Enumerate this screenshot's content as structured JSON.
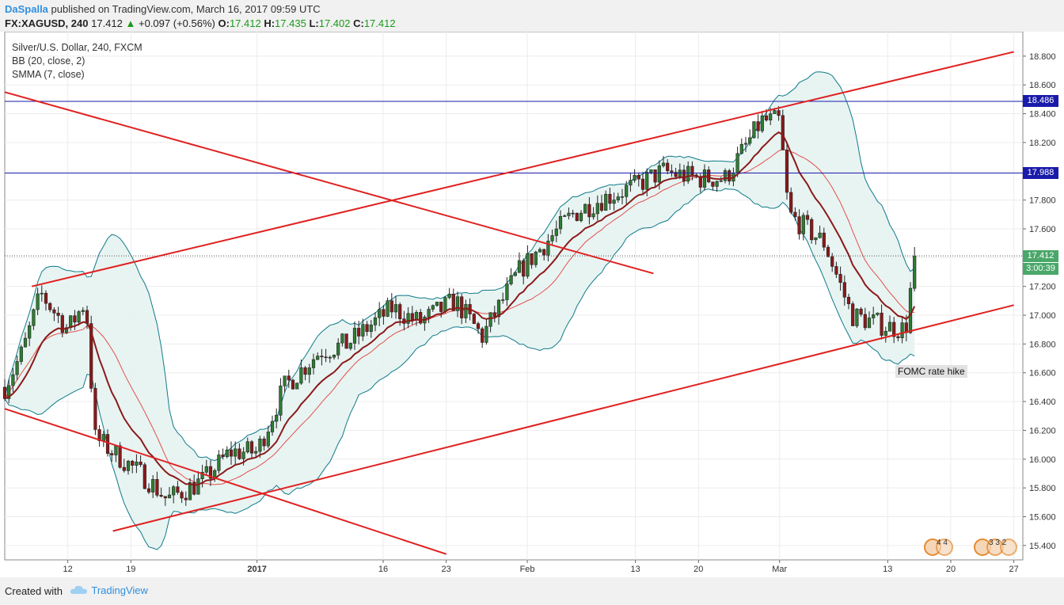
{
  "header": {
    "author": "DaSpalla",
    "published": "published on TradingView.com, March 16, 2017 09:59 UTC",
    "symbol": "FX:XAGUSD, 240",
    "last": "17.412",
    "change": "+0.097 (+0.56%)",
    "open_label": "O:",
    "open": "17.412",
    "high_label": "H:",
    "high": "17.435",
    "low_label": "L:",
    "low": "17.402",
    "close_label": "C:",
    "close": "17.412"
  },
  "legend": {
    "instrument": "Silver/U.S. Dollar, 240, FXCM",
    "bb": "BB (20, close, 2)",
    "smma": "SMMA (7, close)"
  },
  "footer": {
    "created_with": "Created with",
    "brand": "TradingView"
  },
  "annotation": "FOMC rate hike",
  "flags": {
    "left": "4  4",
    "right": "3  3  2"
  },
  "colors": {
    "up": "#2e7d32",
    "down": "#8b1a1a",
    "trendline": "#e02020",
    "level": "#1a1aaa",
    "bb": "#0f7a8a",
    "smma": "#8b1a1a",
    "price_label": "#4aa76a"
  },
  "chart_data": {
    "type": "candlestick",
    "title": "Silver/U.S. Dollar, 240, FXCM",
    "ylim": [
      15.3,
      18.97
    ],
    "y_ticks": [
      "15.400",
      "15.600",
      "15.800",
      "16.000",
      "16.200",
      "16.400",
      "16.600",
      "16.800",
      "17.000",
      "17.200",
      "17.400",
      "17.600",
      "17.800",
      "18.000",
      "18.200",
      "18.400",
      "18.600",
      "18.800"
    ],
    "x_ticks": [
      {
        "label": "12",
        "date": "2016-12-12"
      },
      {
        "label": "19",
        "date": "2016-12-19"
      },
      {
        "label": "2017",
        "date": "2017-01-02"
      },
      {
        "label": "16",
        "date": "2017-01-16"
      },
      {
        "label": "23",
        "date": "2017-01-23"
      },
      {
        "label": "Feb",
        "date": "2017-02-01"
      },
      {
        "label": "13",
        "date": "2017-02-13"
      },
      {
        "label": "20",
        "date": "2017-02-20"
      },
      {
        "label": "Mar",
        "date": "2017-03-01"
      },
      {
        "label": "13",
        "date": "2017-03-13"
      },
      {
        "label": "20",
        "date": "2017-03-20"
      },
      {
        "label": "27",
        "date": "2017-03-27"
      }
    ],
    "close_path": [
      {
        "date": "2016-12-05",
        "close": 16.5
      },
      {
        "date": "2016-12-07",
        "close": 16.75
      },
      {
        "date": "2016-12-09",
        "close": 17.15
      },
      {
        "date": "2016-12-12",
        "close": 16.9
      },
      {
        "date": "2016-12-14",
        "close": 17.1
      },
      {
        "date": "2016-12-15",
        "close": 16.15
      },
      {
        "date": "2016-12-19",
        "close": 15.95
      },
      {
        "date": "2016-12-21",
        "close": 15.85
      },
      {
        "date": "2016-12-23",
        "close": 15.72
      },
      {
        "date": "2016-12-27",
        "close": 15.85
      },
      {
        "date": "2016-12-30",
        "close": 16.05
      },
      {
        "date": "2017-01-02",
        "close": 16.05
      },
      {
        "date": "2017-01-05",
        "close": 16.5
      },
      {
        "date": "2017-01-09",
        "close": 16.75
      },
      {
        "date": "2017-01-12",
        "close": 16.8
      },
      {
        "date": "2017-01-17",
        "close": 17.05
      },
      {
        "date": "2017-01-20",
        "close": 16.95
      },
      {
        "date": "2017-01-24",
        "close": 17.1
      },
      {
        "date": "2017-01-27",
        "close": 16.85
      },
      {
        "date": "2017-01-31",
        "close": 17.3
      },
      {
        "date": "2017-02-03",
        "close": 17.5
      },
      {
        "date": "2017-02-06",
        "close": 17.7
      },
      {
        "date": "2017-02-09",
        "close": 17.8
      },
      {
        "date": "2017-02-13",
        "close": 17.9
      },
      {
        "date": "2017-02-16",
        "close": 18.0
      },
      {
        "date": "2017-02-20",
        "close": 17.95
      },
      {
        "date": "2017-02-23",
        "close": 17.95
      },
      {
        "date": "2017-02-27",
        "close": 18.35
      },
      {
        "date": "2017-03-01",
        "close": 18.35
      },
      {
        "date": "2017-03-02",
        "close": 17.7
      },
      {
        "date": "2017-03-06",
        "close": 17.5
      },
      {
        "date": "2017-03-09",
        "close": 17.0
      },
      {
        "date": "2017-03-13",
        "close": 16.92
      },
      {
        "date": "2017-03-15",
        "close": 16.9
      },
      {
        "date": "2017-03-16",
        "close": 17.412
      }
    ],
    "horizontal_levels": [
      {
        "value": 18.486,
        "label": "18.486"
      },
      {
        "value": 17.988,
        "label": "17.988"
      }
    ],
    "last_price": {
      "value": 17.412,
      "label": "17.412",
      "countdown": "3:00:39"
    },
    "trendlines": [
      {
        "from": {
          "date": "2016-12-08",
          "price": 17.2
        },
        "to": {
          "date": "2017-03-27",
          "price": 18.83
        }
      },
      {
        "from": {
          "date": "2016-12-17",
          "price": 15.5
        },
        "to": {
          "date": "2017-03-27",
          "price": 17.07
        }
      },
      {
        "from": {
          "date": "2016-12-05",
          "price": 18.55
        },
        "to": {
          "date": "2017-02-15",
          "price": 17.29
        }
      },
      {
        "from": {
          "date": "2016-12-05",
          "price": 16.35
        },
        "to": {
          "date": "2017-01-23",
          "price": 15.34
        }
      }
    ],
    "indicators": [
      "BB (20, close, 2)",
      "SMMA (7, close)"
    ]
  }
}
